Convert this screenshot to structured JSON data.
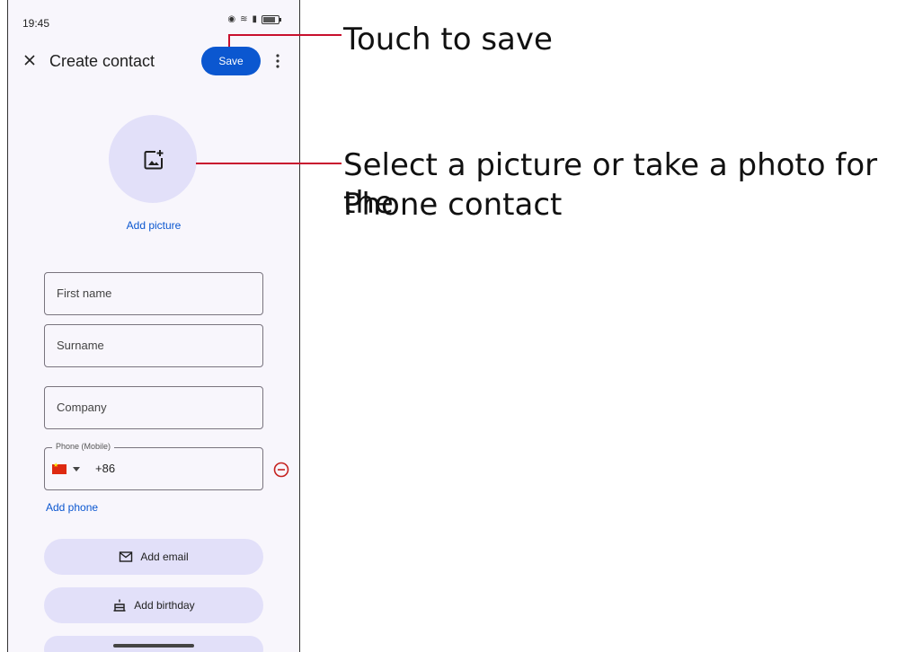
{
  "status_bar": {
    "time": "19:45",
    "icons": [
      "vibrate-icon",
      "wifi-icon",
      "volte-icon",
      "signal-icon",
      "battery-icon"
    ],
    "battery_level": 0.8
  },
  "app_bar": {
    "title": "Create contact",
    "save_label": "Save"
  },
  "photo": {
    "add_picture_label": "Add picture"
  },
  "form": {
    "first_name_placeholder": "First name",
    "surname_placeholder": "Surname",
    "company_placeholder": "Company",
    "phone_label": "Phone (Mobile)",
    "phone_country_code": "+86",
    "add_phone_label": "Add phone"
  },
  "buttons": {
    "add_email_label": "Add email",
    "add_birthday_label": "Add birthday"
  },
  "callouts": {
    "save": "Touch to save",
    "picture_line1": "Select a picture or take a photo for the",
    "picture_line2": "Phone contact"
  },
  "colors": {
    "accent": "#0b57d0",
    "callout_line": "#c8102e",
    "tonal_button": "#e2e0f9",
    "remove": "#c5221f"
  }
}
